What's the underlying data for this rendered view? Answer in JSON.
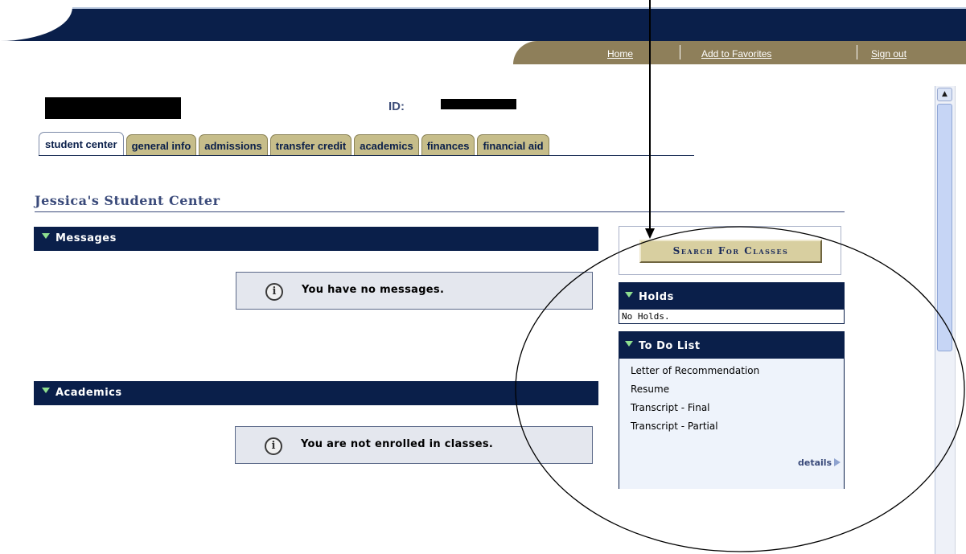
{
  "header": {
    "links": [
      {
        "label": "Home"
      },
      {
        "label": "Add to Favorites"
      },
      {
        "label": "Sign out"
      }
    ]
  },
  "student": {
    "id_label": "ID:"
  },
  "tabs": [
    {
      "label": "student center",
      "active": true
    },
    {
      "label": "general info",
      "active": false
    },
    {
      "label": "admissions",
      "active": false
    },
    {
      "label": "transfer credit",
      "active": false
    },
    {
      "label": "academics",
      "active": false
    },
    {
      "label": "finances",
      "active": false
    },
    {
      "label": "financial aid",
      "active": false
    }
  ],
  "page": {
    "title": "Jessica's Student Center"
  },
  "messages": {
    "heading": "Messages",
    "info_text": "You have no messages."
  },
  "academics": {
    "heading": "Academics",
    "info_text": "You are not enrolled in classes."
  },
  "sidebar": {
    "search_button": "Search For Classes",
    "holds": {
      "heading": "Holds",
      "body": "No Holds."
    },
    "todo": {
      "heading": "To Do List",
      "items": [
        "Letter of Recommendation",
        "Resume",
        "Transcript - Final",
        "Transcript - Partial"
      ],
      "details_link": "details"
    }
  },
  "colors": {
    "navy": "#0a1f4a",
    "gold": "#8e7f5a",
    "tab_tan": "#c6bd8a",
    "title_blue": "#3a4a7a"
  },
  "icons": [
    "info-icon",
    "expand-triangle-icon",
    "play-arrow-icon",
    "scroll-up-arrow-icon"
  ]
}
